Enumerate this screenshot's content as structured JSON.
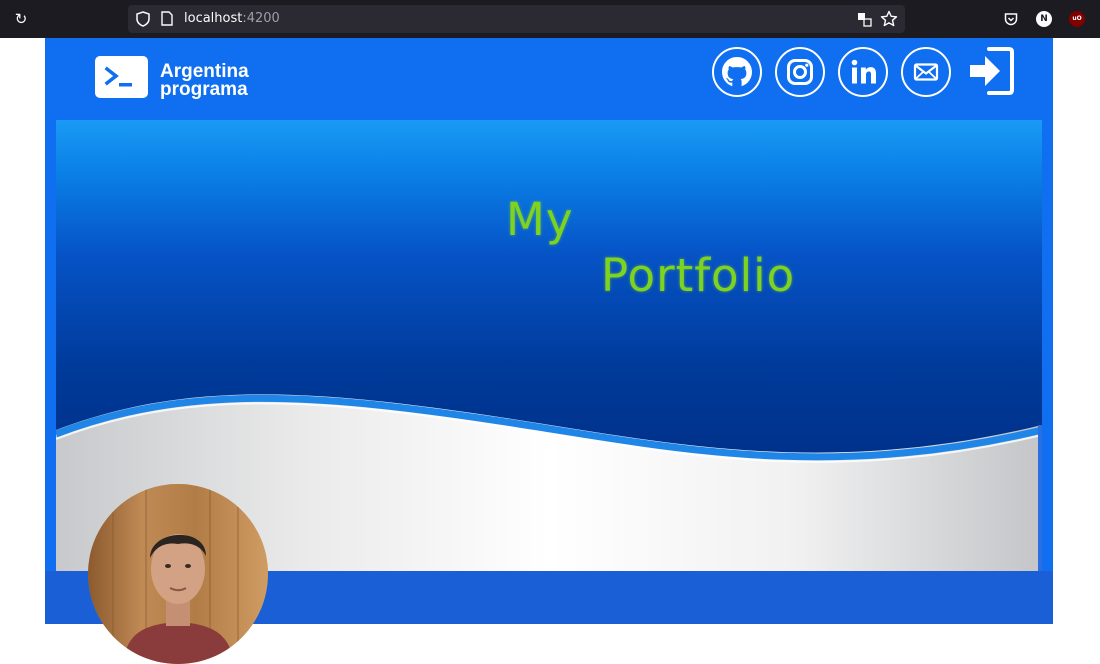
{
  "browser": {
    "url_host": "localhost",
    "url_port": ":4200",
    "profile_initial": "N",
    "extension_badge": "uO"
  },
  "header": {
    "logo_line1": "Argentina",
    "logo_line2": "programa",
    "social_icons": [
      "github-icon",
      "instagram-icon",
      "linkedin-icon",
      "mail-icon"
    ],
    "login_icon": "login-icon"
  },
  "banner": {
    "title_line1": "My",
    "title_line2": "Portfolio"
  },
  "colors": {
    "page_blue": "#0f6ff0",
    "bottom_bar": "#1a5fd6",
    "title_green": "#7ed321",
    "banner_dark": "#002f86"
  }
}
